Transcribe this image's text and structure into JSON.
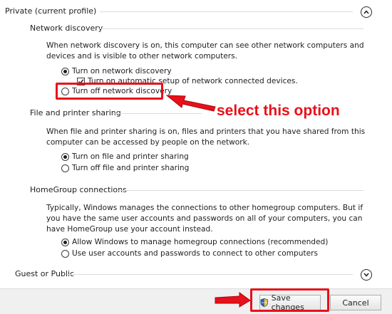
{
  "private_profile": {
    "title": "Private (current profile)",
    "network_discovery": {
      "title": "Network discovery",
      "description": "When network discovery is on, this computer can see other network computers and devices and is visible to other network computers.",
      "option_on": "Turn on network discovery",
      "auto_setup": "Turn on automatic setup of network connected devices.",
      "option_off": "Turn off network discovery"
    },
    "file_printer_sharing": {
      "title": "File and printer sharing",
      "description": "When file and printer sharing is on, files and printers that you have shared from this computer can be accessed by people on the network.",
      "option_on": "Turn on file and printer sharing",
      "option_off": "Turn off file and printer sharing"
    },
    "homegroup": {
      "title": "HomeGroup connections",
      "description": "Typically, Windows manages the connections to other homegroup computers. But if you have the same user accounts and passwords on all of your computers, you can have HomeGroup use your account instead.",
      "option_windows": "Allow Windows to manage homegroup connections (recommended)",
      "option_user": "Use user accounts and passwords to connect to other computers"
    }
  },
  "guest_profile": {
    "title": "Guest or Public"
  },
  "footer": {
    "save_label": "Save changes",
    "cancel_label": "Cancel"
  },
  "annotation": {
    "text": "select this option",
    "color": "#e8101a"
  },
  "icons": {
    "collapse": "chevron-up-icon",
    "expand": "chevron-down-icon",
    "shield": "uac-shield-icon"
  }
}
